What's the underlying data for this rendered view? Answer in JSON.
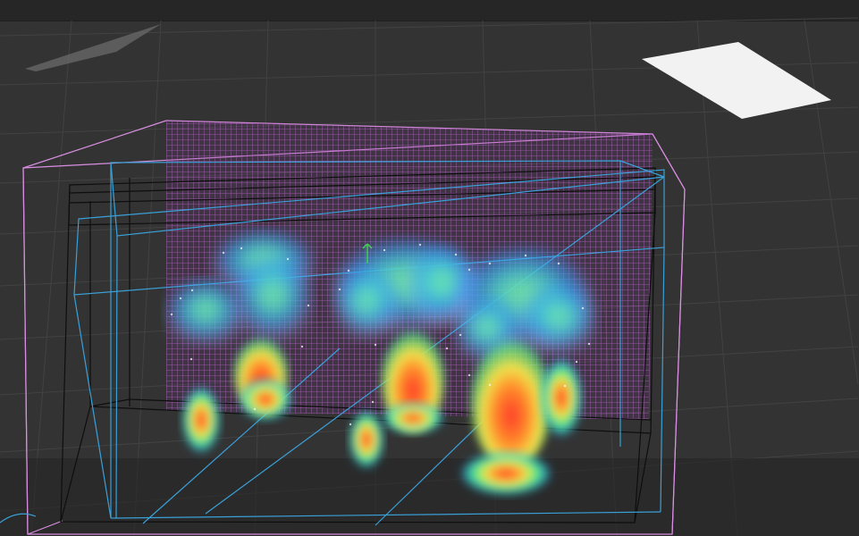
{
  "viewport": {
    "label": "",
    "background_color": "#333333",
    "grid_color": "#3f3f3f",
    "bounding_box_color": "#d88ee0",
    "secondary_box_color": "#3aa0d8",
    "inner_box_color": "#101010",
    "floor_shadow_color": "#2a2a2a"
  },
  "scene": {
    "objects": [
      {
        "name": "fluid-container-box",
        "icon": "box-outline"
      },
      {
        "name": "voxel-grid-panel",
        "icon": "grid"
      },
      {
        "name": "simulation-particles",
        "icon": "particles"
      },
      {
        "name": "light-plane-left",
        "icon": "plane"
      },
      {
        "name": "light-plane-right",
        "icon": "plane"
      }
    ],
    "heat_colors": [
      "#2a8cff",
      "#2fd0d8",
      "#5cf07a",
      "#f2e24a",
      "#ff8a2a",
      "#ff3b2a"
    ]
  }
}
